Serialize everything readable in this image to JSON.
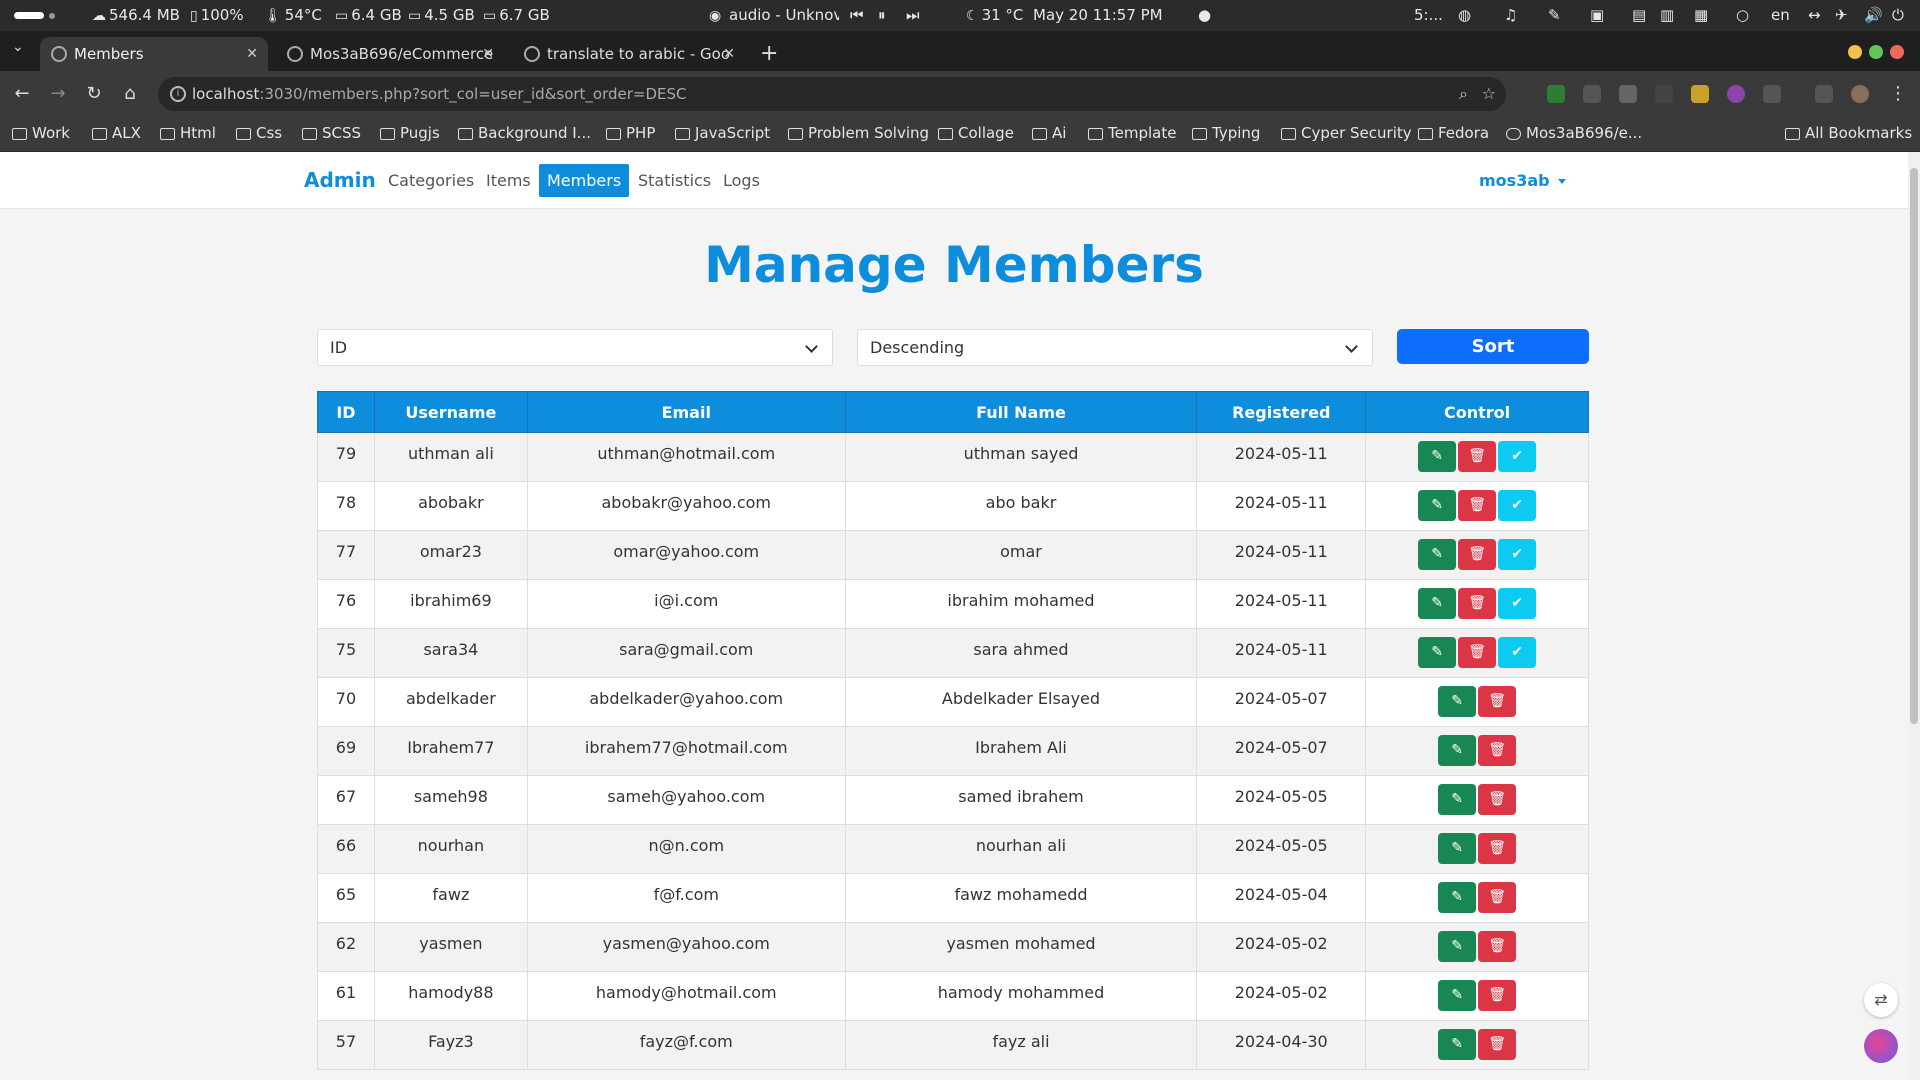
{
  "os_bar": {
    "net": "546.4 MB",
    "battery": "100%",
    "temp": "54°C",
    "mem1": "6.4 GB",
    "mem2": "4.5 GB",
    "mem3": "6.7 GB",
    "media_title": "audio - Unknov",
    "weather": "31 °C",
    "datetime": "May 20  11:57 PM",
    "truncated_label": "5:...",
    "lang": "en"
  },
  "browser": {
    "tabs": [
      {
        "title": "Members"
      },
      {
        "title": "Mos3aB696/eCommerce"
      },
      {
        "title": "translate to arabic - Goo"
      }
    ],
    "url_host": "localhost",
    "url_rest": ":3030/members.php?sort_col=user_id&sort_order=DESC",
    "bookmarks": [
      "Work",
      "ALX",
      "Html",
      "Css",
      "SCSS",
      "Pugjs",
      "Background I...",
      "PHP",
      "JavaScript",
      "Problem Solving",
      "Collage",
      "Ai",
      "Template",
      "Typing",
      "Cyper Security",
      "Fedora",
      "Mos3aB696/e...",
      "All Bookmarks"
    ]
  },
  "nav": {
    "brand": "Admin",
    "links": [
      "Categories",
      "Items",
      "Members",
      "Statistics",
      "Logs"
    ],
    "active": "Members",
    "user": "mos3ab"
  },
  "page": {
    "title": "Manage Members",
    "sort_col_value": "ID",
    "sort_order_value": "Descending",
    "sort_button": "Sort"
  },
  "table": {
    "headers": [
      "ID",
      "Username",
      "Email",
      "Full Name",
      "Registered",
      "Control"
    ],
    "rows": [
      {
        "id": "79",
        "username": "uthman ali",
        "email": "uthman@hotmail.com",
        "full_name": "uthman sayed",
        "registered": "2024-05-11",
        "pending": true
      },
      {
        "id": "78",
        "username": "abobakr",
        "email": "abobakr@yahoo.com",
        "full_name": "abo bakr",
        "registered": "2024-05-11",
        "pending": true
      },
      {
        "id": "77",
        "username": "omar23",
        "email": "omar@yahoo.com",
        "full_name": "omar",
        "registered": "2024-05-11",
        "pending": true
      },
      {
        "id": "76",
        "username": "ibrahim69",
        "email": "i@i.com",
        "full_name": "ibrahim mohamed",
        "registered": "2024-05-11",
        "pending": true
      },
      {
        "id": "75",
        "username": "sara34",
        "email": "sara@gmail.com",
        "full_name": "sara ahmed",
        "registered": "2024-05-11",
        "pending": true
      },
      {
        "id": "70",
        "username": "abdelkader",
        "email": "abdelkader@yahoo.com",
        "full_name": "Abdelkader Elsayed",
        "registered": "2024-05-07",
        "pending": false
      },
      {
        "id": "69",
        "username": "Ibrahem77",
        "email": "ibrahem77@hotmail.com",
        "full_name": "Ibrahem Ali",
        "registered": "2024-05-07",
        "pending": false
      },
      {
        "id": "67",
        "username": "sameh98",
        "email": "sameh@yahoo.com",
        "full_name": "samed ibrahem",
        "registered": "2024-05-05",
        "pending": false
      },
      {
        "id": "66",
        "username": "nourhan",
        "email": "n@n.com",
        "full_name": "nourhan ali",
        "registered": "2024-05-05",
        "pending": false
      },
      {
        "id": "65",
        "username": "fawz",
        "email": "f@f.com",
        "full_name": "fawz mohamedd",
        "registered": "2024-05-04",
        "pending": false
      },
      {
        "id": "62",
        "username": "yasmen",
        "email": "yasmen@yahoo.com",
        "full_name": "yasmen mohamed",
        "registered": "2024-05-02",
        "pending": false
      },
      {
        "id": "61",
        "username": "hamody88",
        "email": "hamody@hotmail.com",
        "full_name": "hamody mohammed",
        "registered": "2024-05-02",
        "pending": false
      },
      {
        "id": "57",
        "username": "Fayz3",
        "email": "fayz@f.com",
        "full_name": "fayz ali",
        "registered": "2024-04-30",
        "pending": false
      }
    ]
  },
  "colors": {
    "accent": "#0d8ddb",
    "sort_button": "#0d6efd",
    "edit": "#198754",
    "delete": "#dc3545",
    "activate": "#0dcaf0"
  }
}
